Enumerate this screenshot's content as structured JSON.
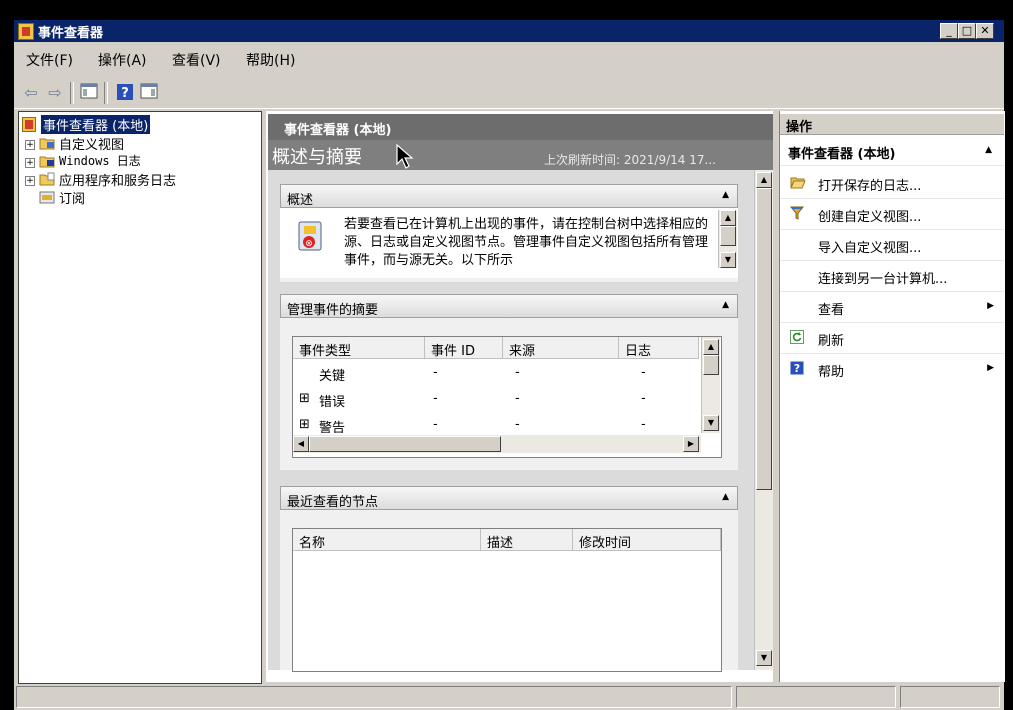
{
  "window": {
    "title": "事件查看器"
  },
  "menu": [
    "文件(F)",
    "操作(A)",
    "查看(V)",
    "帮助(H)"
  ],
  "tree": {
    "root": "事件查看器 (本地)",
    "items": [
      "自定义视图",
      "Windows 日志",
      "应用程序和服务日志",
      "订阅"
    ]
  },
  "center": {
    "header": "事件查看器 (本地)",
    "overview_title": "概述与摘要",
    "last_refresh": "上次刷新时间: 2021/9/14 17...",
    "summary_panel": {
      "title": "概述",
      "text": "若要查看已在计算机上出现的事件，请在控制台树中选择相应的源、日志或自定义视图节点。管理事件自定义视图包括所有管理事件，而与源无关。以下所示"
    },
    "admin_panel": {
      "title": "管理事件的摘要",
      "columns": [
        "事件类型",
        "事件 ID",
        "来源",
        "日志"
      ],
      "rows": [
        {
          "expander": "",
          "type": "关键",
          "id": "-",
          "source": "-",
          "log": "-"
        },
        {
          "expander": "⊞",
          "type": "错误",
          "id": "-",
          "source": "-",
          "log": "-"
        },
        {
          "expander": "⊞",
          "type": "警告",
          "id": "-",
          "source": "-",
          "log": "-"
        }
      ]
    },
    "recent_panel": {
      "title": "最近查看的节点",
      "columns": [
        "名称",
        "描述",
        "修改时间"
      ]
    }
  },
  "actions": {
    "header": "操作",
    "section": "事件查看器 (本地)",
    "items": [
      {
        "label": "打开保存的日志...",
        "icon": "folder-open-icon",
        "submenu": false
      },
      {
        "label": "创建自定义视图...",
        "icon": "filter-icon",
        "submenu": false
      },
      {
        "label": "导入自定义视图...",
        "icon": "",
        "submenu": false
      },
      {
        "label": "连接到另一台计算机...",
        "icon": "",
        "submenu": false
      },
      {
        "label": "查看",
        "icon": "",
        "submenu": true
      },
      {
        "label": "刷新",
        "icon": "refresh-icon",
        "submenu": false
      },
      {
        "label": "帮助",
        "icon": "help-icon",
        "submenu": true
      }
    ]
  },
  "colors": {
    "titlebar": "#0a246a",
    "pane_header": "#6d6d6d",
    "selection": "#0a246a"
  }
}
